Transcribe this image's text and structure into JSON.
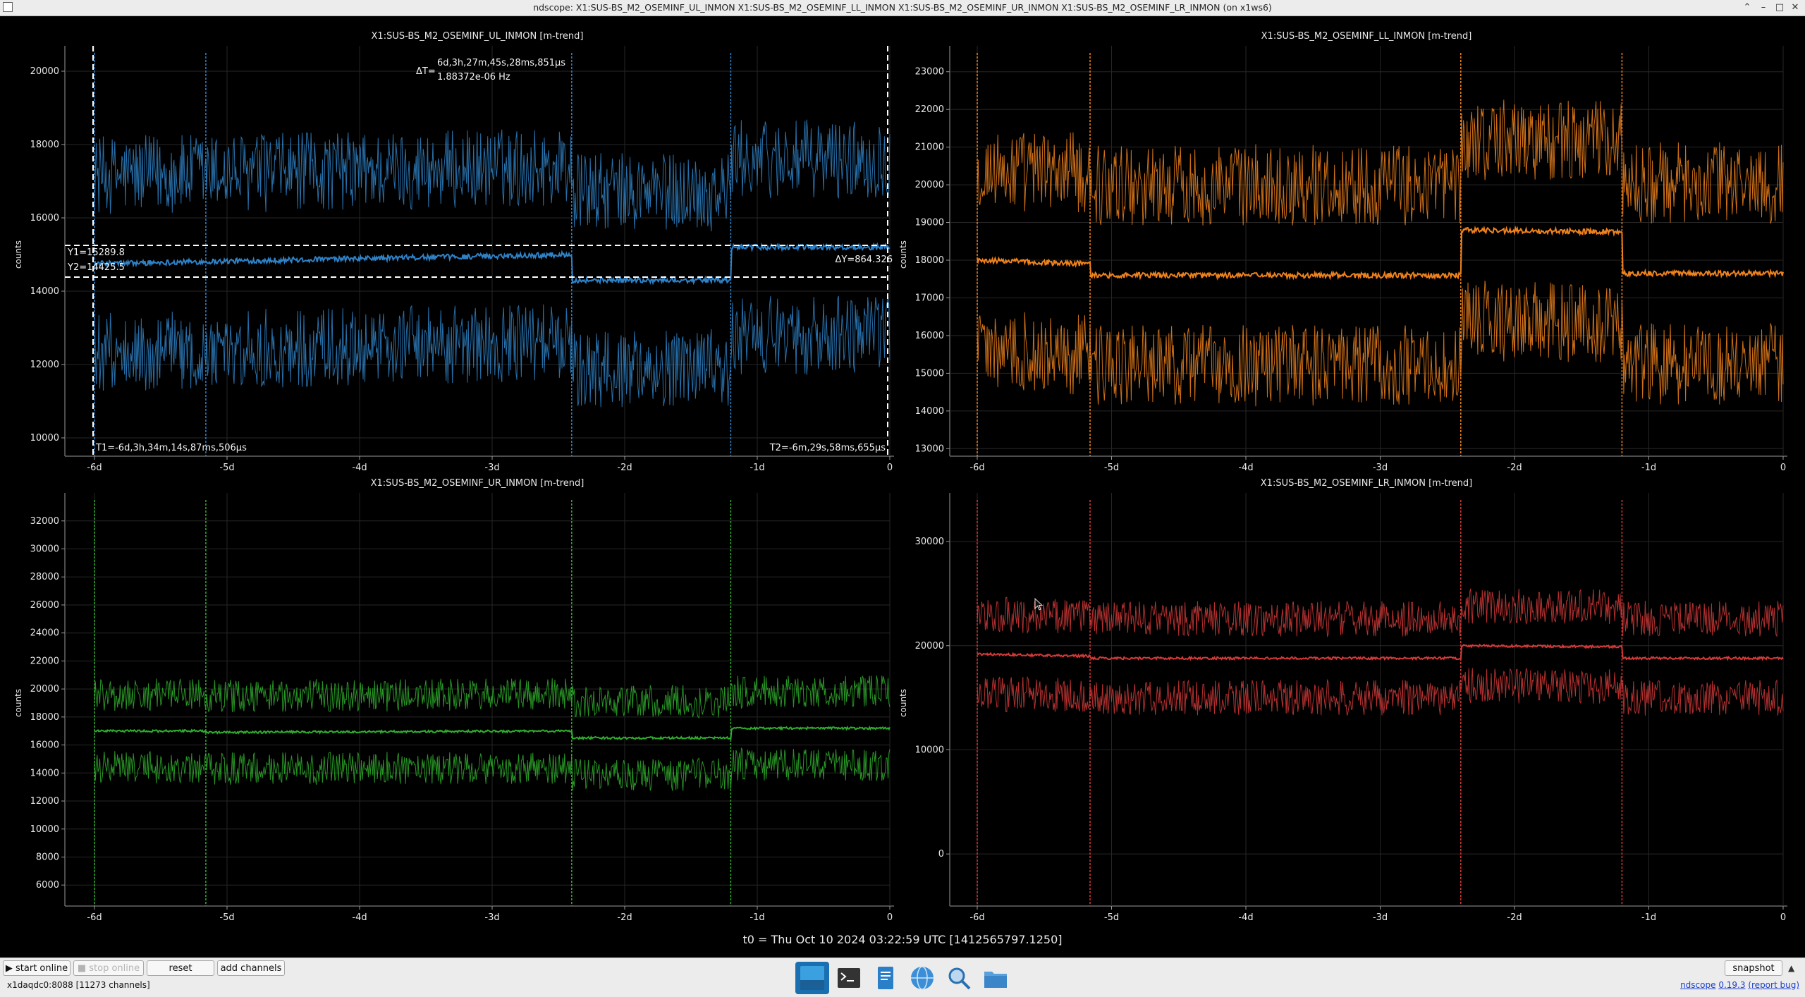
{
  "window": {
    "title": "ndscope: X1:SUS-BS_M2_OSEMINF_UL_INMON X1:SUS-BS_M2_OSEMINF_LL_INMON X1:SUS-BS_M2_OSEMINF_UR_INMON X1:SUS-BS_M2_OSEMINF_LR_INMON (on x1ws6)",
    "minimize": "⌃",
    "min2": "–",
    "max": "□",
    "close": "✕"
  },
  "x_ticks": [
    "-6d",
    "-5d",
    "-4d",
    "-3d",
    "-2d",
    "-1d",
    "0"
  ],
  "plots": [
    {
      "id": "ul",
      "title": "X1:SUS-BS_M2_OSEMINF_UL_INMON [m-trend]",
      "ylabel": "counts",
      "color": "#2f82c7",
      "yticks": [
        "20000",
        "18000",
        "16000",
        "14000",
        "12000",
        "10000"
      ],
      "ylim": [
        9500,
        20500
      ]
    },
    {
      "id": "ll",
      "title": "X1:SUS-BS_M2_OSEMINF_LL_INMON [m-trend]",
      "ylabel": "counts",
      "color": "#f0821c",
      "yticks": [
        "23000",
        "22000",
        "21000",
        "20000",
        "19000",
        "18000",
        "17000",
        "16000",
        "15000",
        "14000",
        "13000"
      ],
      "ylim": [
        12800,
        23500
      ]
    },
    {
      "id": "ur",
      "title": "X1:SUS-BS_M2_OSEMINF_UR_INMON [m-trend]",
      "ylabel": "counts",
      "color": "#2fae2c",
      "yticks": [
        "32000",
        "30000",
        "28000",
        "26000",
        "24000",
        "22000",
        "20000",
        "18000",
        "16000",
        "14000",
        "12000",
        "10000",
        "8000",
        "6000"
      ],
      "ylim": [
        4500,
        33500
      ]
    },
    {
      "id": "lr",
      "title": "X1:SUS-BS_M2_OSEMINF_LR_INMON [m-trend]",
      "ylabel": "counts",
      "color": "#d43a38",
      "yticks": [
        "30000",
        "20000",
        "10000",
        "0"
      ],
      "ylim": [
        -5000,
        34000
      ]
    }
  ],
  "cursors": {
    "delta_t": "ΔT=",
    "delta_t_value": "6d,3h,27m,45s,28ms,851µs",
    "delta_freq": "1.88372e-06 Hz",
    "y1": "Y1=15289.8",
    "y2": "Y2=14425.5",
    "delta_y": "ΔY=864.326",
    "t1": "T1=-6d,3h,34m,14s,87ms,506µs",
    "t2": "T2=-6m,29s,58ms,655µs"
  },
  "t0": "t0 = Thu Oct 10 2024 03:22:59 UTC [1412565797.1250]",
  "controls": {
    "start_online": "▶ start online",
    "stop_online": "■ stop online",
    "reset": "reset",
    "add_channels": "add channels",
    "snapshot": "snapshot",
    "status": "x1daqdc0:8088  [11273 channels]",
    "app_name": "ndscope",
    "version": "0.19.3",
    "report_bug": "(report bug)"
  },
  "colors": {
    "grid": "#2a2a2a",
    "cursor": "#ffffff",
    "ul": "#2f82c7",
    "ll": "#f0821c",
    "ur": "#2fae2c",
    "lr": "#d43a38"
  },
  "taskbar": [
    "window-icon",
    "terminal-icon",
    "document-icon",
    "browser-globe-icon",
    "magnifier-icon",
    "folder-icon"
  ]
}
